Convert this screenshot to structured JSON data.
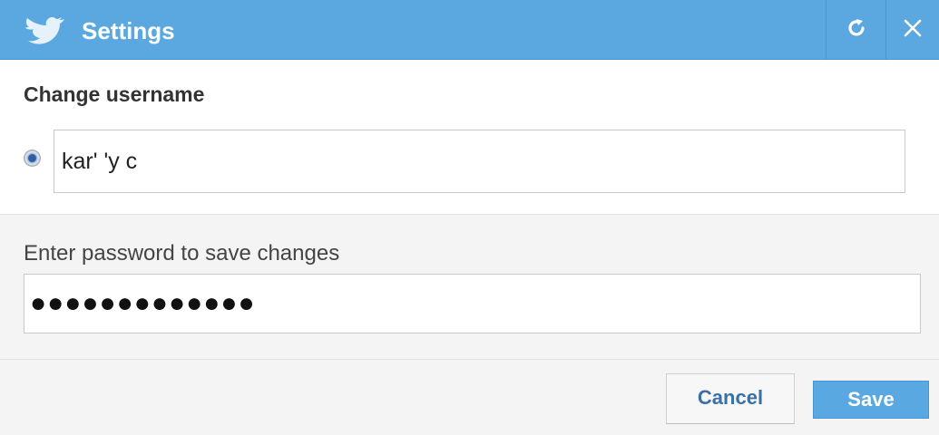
{
  "window": {
    "title": "Settings",
    "refresh_icon": "refresh-icon",
    "close_icon": "close-icon",
    "brand_icon": "twitter-bird-icon",
    "accent_color": "#5ba8e0"
  },
  "username": {
    "heading": "Change username",
    "value": "kar' 'y c",
    "selected": true
  },
  "password": {
    "label": "Enter password to save changes",
    "value": "●●●●●●●●●●●●●"
  },
  "actions": {
    "cancel_label": "Cancel",
    "save_label": "Save"
  }
}
